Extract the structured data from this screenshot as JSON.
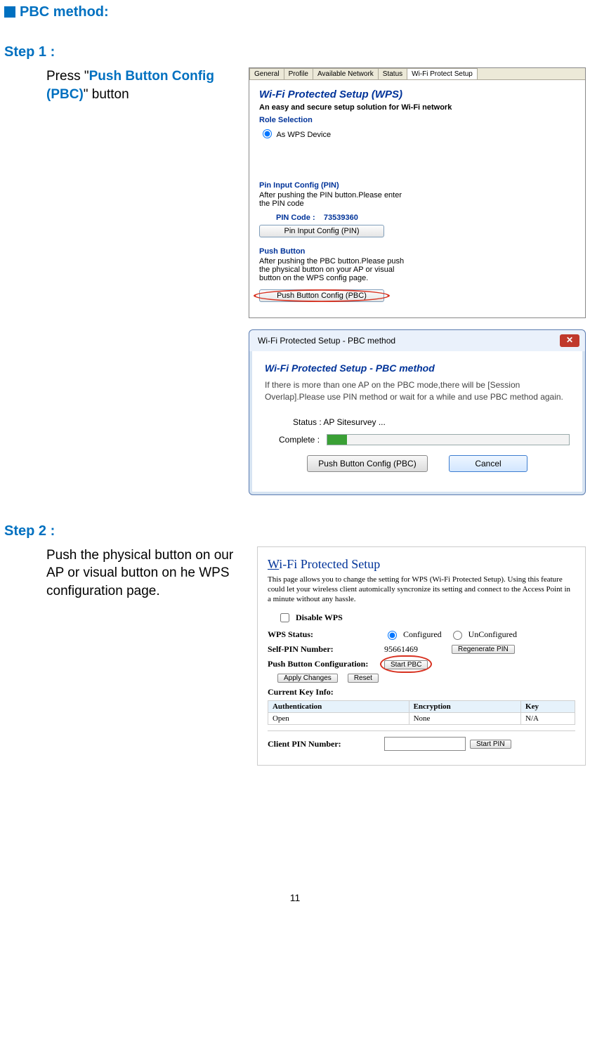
{
  "header": "PBC method:",
  "step1": {
    "title": "Step 1 :",
    "text_parts": [
      "Press \"",
      "Push Button Config (PBC)",
      "\" button"
    ]
  },
  "wps": {
    "tabs": [
      "General",
      "Profile",
      "Available Network",
      "Status",
      "Wi-Fi Protect Setup"
    ],
    "title": "Wi-Fi Protected Setup (WPS)",
    "subtitle": "An easy and secure setup solution for Wi-Fi network",
    "role_label": "Role Selection",
    "role_option": "As WPS Device",
    "pin_section_title": "Pin Input Config (PIN)",
    "pin_desc": "After pushing the PIN button.Please enter the PIN code",
    "pin_code_label": "PIN Code :",
    "pin_code_value": "73539360",
    "pin_btn": "Pin Input Config (PIN)",
    "push_section_title": "Push Button",
    "push_desc": "After pushing the PBC button.Please push the physical button on your AP or visual button on the WPS config page.",
    "pbc_btn": "Push Button Config (PBC)"
  },
  "pbc_dialog": {
    "window_title": "Wi-Fi Protected Setup - PBC method",
    "inner_title": "Wi-Fi Protected Setup - PBC method",
    "msg": "If there is more than one AP on the PBC mode,there will be [Session Overlap].Please use PIN method or wait for a while and use PBC method again.",
    "status": "Status : AP Sitesurvey ...",
    "complete_label": "Complete :",
    "pbc_btn": "Push Button Config (PBC)",
    "cancel_btn": "Cancel"
  },
  "step2": {
    "title": "Step 2 :",
    "text": "Push the physical button on our AP or visual button on he WPS configuration page."
  },
  "router": {
    "title": "Wi-Fi Protected Setup",
    "desc": "This page allows you to change the setting for WPS (Wi-Fi Protected Setup). Using this feature could let your wireless client automically syncronize its setting and connect to the Access Point in a minute without any hassle.",
    "disable_wps": "Disable WPS",
    "wps_status_label": "WPS Status:",
    "configured": "Configured",
    "unconfigured": "UnConfigured",
    "self_pin_label": "Self-PIN Number:",
    "self_pin_value": "95661469",
    "regen_btn": "Regenerate PIN",
    "pbc_label": "Push Button Configuration:",
    "start_pbc": "Start PBC",
    "apply": "Apply Changes",
    "reset": "Reset",
    "current_key": "Current Key Info:",
    "table": {
      "headers": [
        "Authentication",
        "Encryption",
        "Key"
      ],
      "row": [
        "Open",
        "None",
        "N/A"
      ]
    },
    "client_pin_label": "Client PIN Number:",
    "start_pin": "Start PIN"
  },
  "page_number": "11"
}
